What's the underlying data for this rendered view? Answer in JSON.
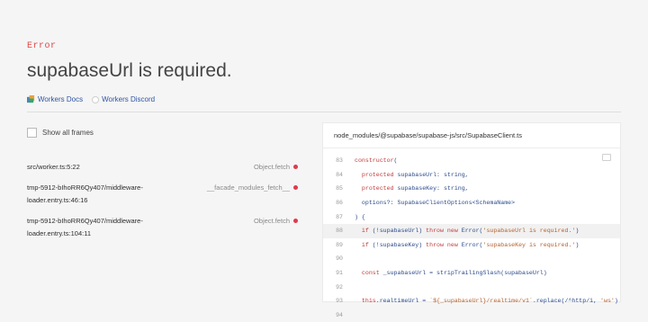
{
  "error": {
    "label": "Error",
    "message": "supabaseUrl is required."
  },
  "links": [
    {
      "label": "Workers Docs",
      "icon": "workers-docs-icon"
    },
    {
      "label": "Workers Discord",
      "icon": "discord-icon"
    }
  ],
  "frames": {
    "show_all_label": "Show all frames",
    "items": [
      {
        "file": "src/worker.ts:5:22",
        "function": "Object.fetch"
      },
      {
        "file": "tmp-5912-bIhoRR6Qy407/middleware-loader.entry.ts:46:16",
        "function": "__facade_modules_fetch__"
      },
      {
        "file": "tmp-5912-bIhoRR6Qy407/middleware-loader.entry.ts:104:11",
        "function": "Object.fetch"
      }
    ]
  },
  "code": {
    "file_path": "node_modules/@supabase/supabase-js/src/SupabaseClient.ts",
    "lines": [
      {
        "n": "83",
        "text": "constructor("
      },
      {
        "n": "84",
        "text": "  protected supabaseUrl: string,"
      },
      {
        "n": "85",
        "text": "  protected supabaseKey: string,"
      },
      {
        "n": "86",
        "text": "  options?: SupabaseClientOptions<SchemaName>"
      },
      {
        "n": "87",
        "text": ") {"
      },
      {
        "n": "88",
        "text": "  if (!supabaseUrl) throw new Error('supabaseUrl is required.')"
      },
      {
        "n": "89",
        "text": "  if (!supabaseKey) throw new Error('supabaseKey is required.')"
      },
      {
        "n": "90",
        "text": ""
      },
      {
        "n": "91",
        "text": "  const _supabaseUrl = stripTrailingSlash(supabaseUrl)"
      },
      {
        "n": "92",
        "text": ""
      },
      {
        "n": "93",
        "text": "  this.realtimeUrl = `${_supabaseUrl}/realtime/v1`.replace(/^http/i, 'ws')"
      },
      {
        "n": "94",
        "text": ""
      }
    ],
    "highlighted_line": "88"
  },
  "colors": {
    "error_red": "#e04848",
    "link_blue": "#2e55a8",
    "dot_red": "#e0394d"
  }
}
